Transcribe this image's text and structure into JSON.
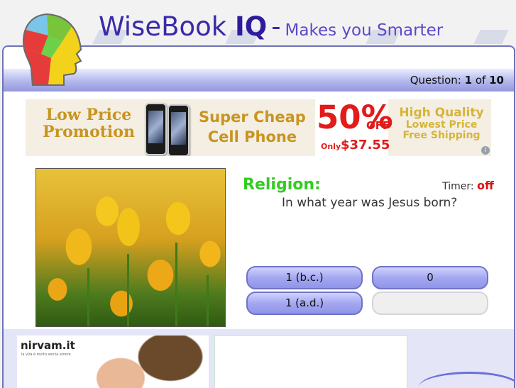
{
  "header": {
    "brand_name": "WiseBook",
    "brand_bold": "IQ",
    "separator": "-",
    "tagline": "Makes you Smarter",
    "logo_icon": "colorful-puzzle-head-icon"
  },
  "question_bar": {
    "prefix": "Question:",
    "current": "1",
    "of_label": "of",
    "total": "10"
  },
  "banner_ad": {
    "left_line1": "Low Price",
    "left_line2": "Promotion",
    "mid_line1": "Super Cheap",
    "mid_line2": "Cell Phone",
    "percent": "50%",
    "off": "OFF",
    "only": "Only",
    "price": "$37.55",
    "right_line1": "High Quality",
    "right_line2": "Lowest Price",
    "right_line3": "Free Shipping",
    "info_icon": "i"
  },
  "quiz": {
    "category": "Religion:",
    "timer_label": "Timer:",
    "timer_value": "off",
    "question": "In what year was Jesus born?",
    "answers": [
      "1 (b.c.)",
      "0",
      "1 (a.d.)",
      ""
    ]
  },
  "bottom_ad": {
    "brand": "nirvam.it",
    "subline": "la vita è molto senza amore"
  },
  "colors": {
    "title": "#3a2aa8",
    "category": "#33cc22",
    "timer_off": "#e01010",
    "answer_button": "#a4a8f0"
  }
}
